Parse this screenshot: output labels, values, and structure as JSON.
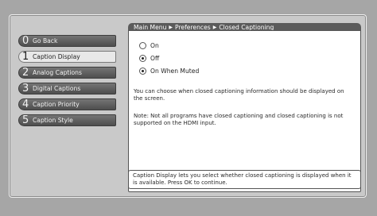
{
  "breadcrumb": {
    "main": "Main Menu",
    "preferences": "Preferences",
    "current": "Closed Captioning"
  },
  "sidebar": {
    "items": [
      {
        "num": "0",
        "label": "Go Back"
      },
      {
        "num": "1",
        "label": "Caption Display"
      },
      {
        "num": "2",
        "label": "Analog Captions"
      },
      {
        "num": "3",
        "label": "Digital Captions"
      },
      {
        "num": "4",
        "label": "Caption Priority"
      },
      {
        "num": "5",
        "label": "Caption Style"
      }
    ],
    "selected_index": 1
  },
  "options": [
    {
      "label": "On",
      "selected": false
    },
    {
      "label": "Off",
      "selected": true
    },
    {
      "label": "On When Muted",
      "selected": true
    }
  ],
  "content": {
    "description": "You can choose when closed captioning information should be displayed on the screen.",
    "note": "Note: Not all programs have closed captioning and closed captioning is not supported on the HDMI input."
  },
  "help_text": "Caption Display lets you select whether closed captioning is displayed when it is available. Press OK to continue."
}
